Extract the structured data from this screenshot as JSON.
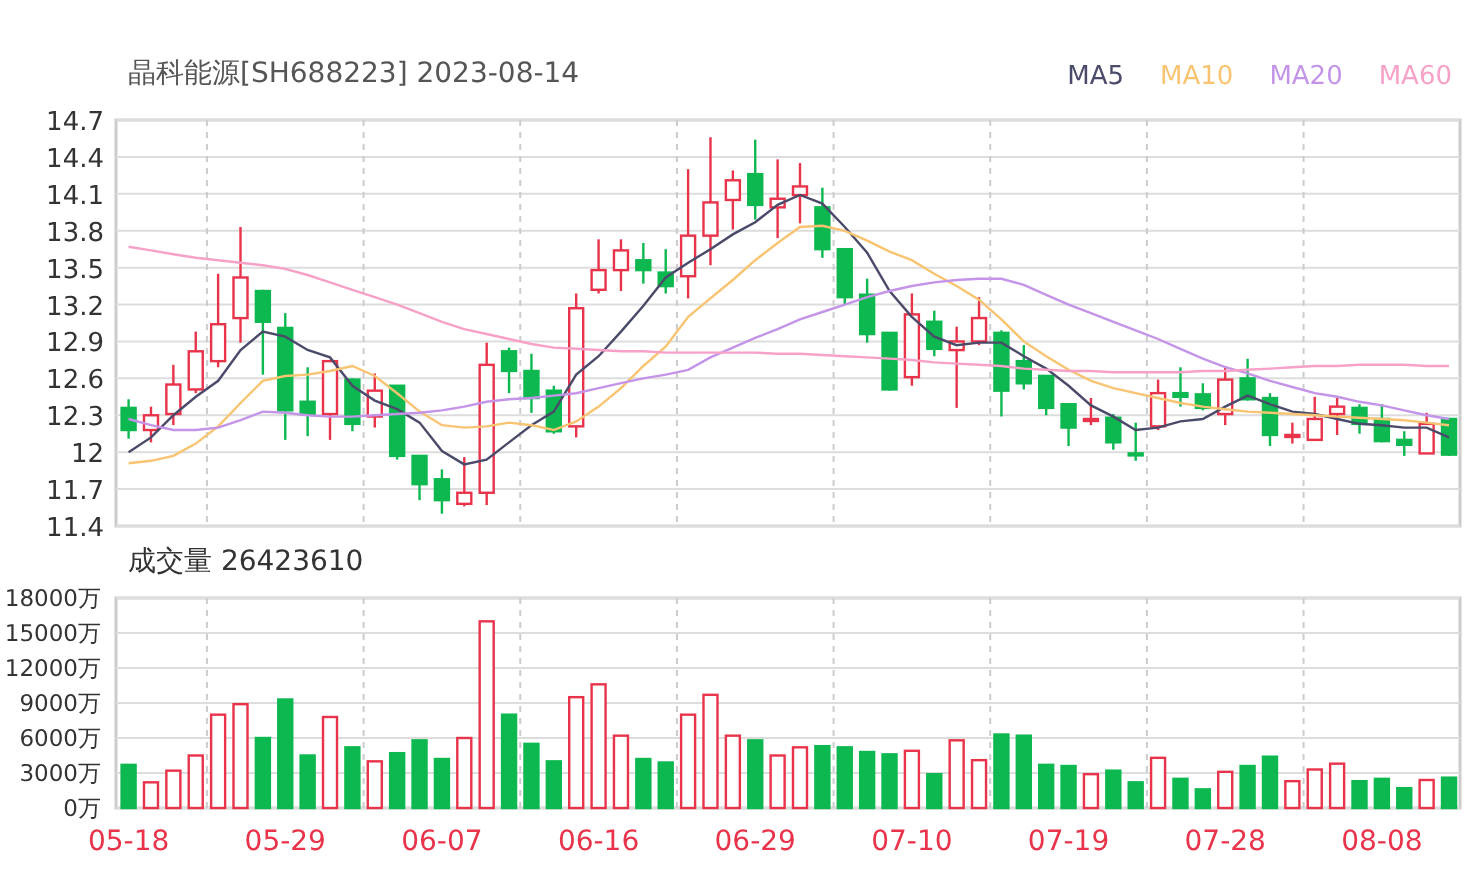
{
  "header": {
    "title": "晶科能源[SH688223] 2023-08-14"
  },
  "price_chart": {
    "chart_data": {
      "type": "candlestick",
      "grid": true,
      "ylim": [
        11.4,
        14.7
      ],
      "yticks": [
        14.7,
        14.4,
        14.1,
        13.8,
        13.5,
        13.2,
        12.9,
        12.6,
        12.3,
        12,
        11.7,
        11.4
      ],
      "series": [
        {
          "name": "MA5",
          "type": "line",
          "color": "#4a4a6a",
          "values": [
            12.0,
            12.12,
            12.3,
            12.45,
            12.58,
            12.83,
            12.98,
            12.94,
            12.83,
            12.77,
            12.54,
            12.42,
            12.35,
            12.24,
            12.01,
            11.9,
            11.94,
            12.08,
            12.22,
            12.33,
            12.63,
            12.78,
            12.98,
            13.19,
            13.42,
            13.54,
            13.65,
            13.77,
            13.87,
            14.01,
            14.09,
            14.02,
            13.83,
            13.62,
            13.31,
            13.1,
            12.94,
            12.87,
            12.89,
            12.89,
            12.78,
            12.68,
            12.54,
            12.38,
            12.29,
            12.18,
            12.2,
            12.25,
            12.27,
            12.37,
            12.46,
            12.39,
            12.33,
            12.31,
            12.27,
            12.23,
            12.22,
            12.2,
            12.2,
            12.12
          ]
        },
        {
          "name": "MA10",
          "type": "line",
          "color": "#f8c471",
          "values": [
            11.91,
            11.93,
            11.97,
            12.07,
            12.21,
            12.4,
            12.58,
            12.62,
            12.63,
            12.66,
            12.7,
            12.62,
            12.48,
            12.33,
            12.22,
            12.2,
            12.21,
            12.24,
            12.22,
            12.18,
            12.25,
            12.37,
            12.52,
            12.7,
            12.86,
            13.1,
            13.25,
            13.4,
            13.56,
            13.7,
            13.83,
            13.84,
            13.8,
            13.72,
            13.63,
            13.56,
            13.45,
            13.35,
            13.24,
            13.08,
            12.9,
            12.78,
            12.67,
            12.58,
            12.52,
            12.48,
            12.44,
            12.4,
            12.37,
            12.35,
            12.33,
            12.32,
            12.31,
            12.3,
            12.29,
            12.28,
            12.27,
            12.26,
            12.24,
            12.22
          ]
        },
        {
          "name": "MA20",
          "type": "line",
          "color": "#c394e8",
          "values": [
            12.27,
            12.22,
            12.18,
            12.18,
            12.2,
            12.26,
            12.33,
            12.32,
            12.3,
            12.29,
            12.29,
            12.3,
            12.31,
            12.32,
            12.34,
            12.37,
            12.41,
            12.43,
            12.44,
            12.46,
            12.48,
            12.52,
            12.56,
            12.6,
            12.63,
            12.67,
            12.77,
            12.85,
            12.93,
            13.0,
            13.08,
            13.14,
            13.2,
            13.26,
            13.31,
            13.35,
            13.38,
            13.4,
            13.41,
            13.41,
            13.36,
            13.28,
            13.2,
            13.13,
            13.06,
            12.99,
            12.92,
            12.84,
            12.76,
            12.69,
            12.64,
            12.58,
            12.53,
            12.48,
            12.45,
            12.41,
            12.38,
            12.34,
            12.3,
            12.27
          ]
        },
        {
          "name": "MA60",
          "type": "line",
          "color": "#f7a1c8",
          "values": [
            13.67,
            13.64,
            13.61,
            13.58,
            13.56,
            13.54,
            13.52,
            13.49,
            13.44,
            13.38,
            13.32,
            13.26,
            13.2,
            13.13,
            13.06,
            13.0,
            12.96,
            12.92,
            12.88,
            12.85,
            12.84,
            12.83,
            12.82,
            12.82,
            12.81,
            12.81,
            12.81,
            12.81,
            12.81,
            12.8,
            12.8,
            12.79,
            12.78,
            12.77,
            12.76,
            12.75,
            12.73,
            12.72,
            12.71,
            12.7,
            12.68,
            12.67,
            12.66,
            12.66,
            12.65,
            12.65,
            12.65,
            12.65,
            12.66,
            12.66,
            12.67,
            12.68,
            12.69,
            12.7,
            12.7,
            12.71,
            12.71,
            12.71,
            12.7,
            12.7
          ]
        }
      ],
      "ohlc": [
        [
          12.36,
          12.43,
          12.11,
          12.18
        ],
        [
          12.18,
          12.37,
          12.08,
          12.3
        ],
        [
          12.31,
          12.71,
          12.22,
          12.55
        ],
        [
          12.51,
          12.98,
          12.48,
          12.82
        ],
        [
          12.74,
          13.45,
          12.69,
          13.04
        ],
        [
          13.09,
          13.83,
          12.89,
          13.42
        ],
        [
          13.31,
          13.32,
          12.63,
          13.06
        ],
        [
          13.01,
          13.13,
          12.1,
          12.34
        ],
        [
          12.41,
          12.69,
          12.13,
          12.31
        ],
        [
          12.31,
          12.74,
          12.1,
          12.74
        ],
        [
          12.59,
          12.6,
          12.17,
          12.23
        ],
        [
          12.29,
          12.64,
          12.2,
          12.5
        ],
        [
          12.54,
          12.54,
          11.94,
          11.97
        ],
        [
          11.97,
          11.97,
          11.61,
          11.74
        ],
        [
          11.78,
          11.86,
          11.5,
          11.61
        ],
        [
          11.58,
          11.96,
          11.56,
          11.67
        ],
        [
          11.67,
          12.89,
          11.57,
          12.71
        ],
        [
          12.82,
          12.85,
          12.48,
          12.66
        ],
        [
          12.66,
          12.8,
          12.32,
          12.44
        ],
        [
          12.5,
          12.54,
          12.15,
          12.17
        ],
        [
          12.21,
          13.29,
          12.12,
          13.17
        ],
        [
          13.32,
          13.73,
          13.29,
          13.48
        ],
        [
          13.48,
          13.73,
          13.31,
          13.64
        ],
        [
          13.56,
          13.7,
          13.37,
          13.48
        ],
        [
          13.46,
          13.65,
          13.29,
          13.35
        ],
        [
          13.43,
          14.3,
          13.25,
          13.76
        ],
        [
          13.76,
          14.56,
          13.52,
          14.03
        ],
        [
          14.05,
          14.29,
          13.81,
          14.21
        ],
        [
          14.26,
          14.54,
          13.89,
          14.01
        ],
        [
          13.99,
          14.38,
          13.74,
          14.06
        ],
        [
          14.09,
          14.35,
          13.86,
          14.16
        ],
        [
          13.99,
          14.15,
          13.58,
          13.65
        ],
        [
          13.65,
          13.65,
          13.2,
          13.26
        ],
        [
          13.28,
          13.41,
          12.89,
          12.96
        ],
        [
          12.97,
          12.97,
          12.5,
          12.51
        ],
        [
          12.61,
          13.29,
          12.54,
          13.12
        ],
        [
          13.06,
          13.15,
          12.78,
          12.84
        ],
        [
          12.83,
          13.02,
          12.36,
          12.9
        ],
        [
          12.9,
          13.26,
          12.87,
          13.09
        ],
        [
          12.97,
          12.99,
          12.29,
          12.5
        ],
        [
          12.74,
          12.87,
          12.51,
          12.56
        ],
        [
          12.62,
          12.62,
          12.3,
          12.36
        ],
        [
          12.39,
          12.39,
          12.05,
          12.2
        ],
        [
          12.26,
          12.44,
          12.22,
          12.27
        ],
        [
          12.28,
          12.31,
          12.02,
          12.08
        ],
        [
          11.99,
          12.24,
          11.93,
          11.98
        ],
        [
          12.21,
          12.59,
          12.18,
          12.48
        ],
        [
          12.48,
          12.69,
          12.37,
          12.45
        ],
        [
          12.47,
          12.56,
          12.34,
          12.36
        ],
        [
          12.31,
          12.7,
          12.22,
          12.59
        ],
        [
          12.6,
          12.76,
          12.42,
          12.43
        ],
        [
          12.44,
          12.48,
          12.05,
          12.14
        ],
        [
          12.13,
          12.24,
          12.07,
          12.14
        ],
        [
          12.1,
          12.45,
          12.1,
          12.27
        ],
        [
          12.31,
          12.44,
          12.14,
          12.37
        ],
        [
          12.36,
          12.39,
          12.15,
          12.23
        ],
        [
          12.27,
          12.39,
          12.08,
          12.09
        ],
        [
          12.1,
          12.17,
          11.97,
          12.06
        ],
        [
          11.99,
          12.32,
          11.99,
          12.23
        ],
        [
          12.27,
          12.27,
          11.97,
          11.98
        ]
      ]
    }
  },
  "volume_panel": {
    "title": "成交量 26423610",
    "chart_data": {
      "type": "bar",
      "grid": true,
      "ylim": [
        0,
        18000
      ],
      "yticks": [
        {
          "value": 18000,
          "label": "18000万"
        },
        {
          "value": 15000,
          "label": "15000万"
        },
        {
          "value": 12000,
          "label": "12000万"
        },
        {
          "value": 9000,
          "label": "9000万"
        },
        {
          "value": 6000,
          "label": "6000万"
        },
        {
          "value": 3000,
          "label": "3000万"
        },
        {
          "value": 0,
          "label": "0万"
        }
      ],
      "categories": [
        "05-18",
        null,
        null,
        null,
        null,
        null,
        null,
        "05-29",
        null,
        null,
        null,
        null,
        null,
        null,
        "06-07",
        null,
        null,
        null,
        null,
        null,
        null,
        "06-16",
        null,
        null,
        null,
        null,
        null,
        null,
        "06-29",
        null,
        null,
        null,
        null,
        null,
        null,
        "07-10",
        null,
        null,
        null,
        null,
        null,
        null,
        "07-19",
        null,
        null,
        null,
        null,
        null,
        null,
        "07-28",
        null,
        null,
        null,
        null,
        null,
        null,
        "08-08",
        null,
        null,
        null
      ],
      "values": [
        3700,
        2200,
        3200,
        4500,
        8000,
        8900,
        6000,
        9300,
        4500,
        7800,
        5200,
        4000,
        4700,
        5800,
        4200,
        6000,
        16000,
        8000,
        5500,
        4000,
        9500,
        10600,
        6200,
        4200,
        3900,
        8000,
        9700,
        6200,
        5800,
        4500,
        5200,
        5300,
        5200,
        4800,
        4600,
        4900,
        2900,
        5800,
        4100,
        6300,
        6200,
        3700,
        3600,
        2900,
        3200,
        2200,
        4300,
        2500,
        1600,
        3100,
        3600,
        4400,
        2300,
        3300,
        3800,
        2300,
        2500,
        1700,
        2400,
        2600
      ]
    }
  }
}
